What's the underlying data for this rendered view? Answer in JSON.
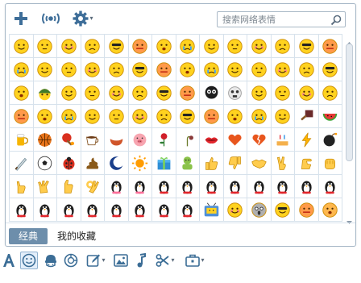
{
  "topbar": {
    "add_icon": "plus-icon",
    "gif_icon": "wifi-gif-icon",
    "settings_icon": "gear-icon"
  },
  "search": {
    "placeholder": "搜索网络表情",
    "icon": "magnifier-icon"
  },
  "tabs": [
    {
      "label": "经典",
      "selected": true
    },
    {
      "label": "我的收藏",
      "selected": false
    }
  ],
  "emoji_rows": [
    [
      "smile",
      "pout",
      "heart-eyes",
      "daze",
      "cool",
      "cry",
      "shy",
      "zip",
      "sleep",
      "weep",
      "awkward",
      "angry",
      "tongue",
      "grin"
    ],
    [
      "surprise",
      "sad",
      "cool-glasses",
      "sweat",
      "crazy",
      "vomit",
      "giggle",
      "cute",
      "roll-eyes",
      "proud",
      "hungry",
      "sleepy",
      "fright",
      "sweat-drop"
    ],
    [
      "laugh",
      "soldier",
      "struggle",
      "curse",
      "question",
      "shh",
      "dizzy",
      "torment",
      "skull",
      "knock",
      "bye",
      "wipe-sweat",
      "pick-nose",
      "clap"
    ],
    [
      "embarrassed",
      "snicker",
      "left-hum",
      "right-hum",
      "yawn",
      "despise",
      "grievance",
      "tear",
      "sly",
      "kiss",
      "scare",
      "pitiful",
      "cleaver",
      "melon"
    ],
    [
      "beer",
      "basketball",
      "ping-pong",
      "coffee",
      "rice",
      "pig",
      "rose",
      "wilt",
      "lips",
      "heart",
      "broken-heart",
      "cake",
      "lightning",
      "bomb"
    ],
    [
      "knife",
      "football",
      "ladybug",
      "poop",
      "moon",
      "sun",
      "gift",
      "hug",
      "thumbs-up",
      "thumbs-down",
      "handshake",
      "victory",
      "salute",
      "fist"
    ],
    [
      "pinky",
      "love-you",
      "no",
      "ok",
      "couple",
      "couple-kiss",
      "penguin-dance",
      "penguin-shiver",
      "penguin-angry",
      "penguin-spin",
      "penguin-jump",
      "penguin-wave",
      "penguin-kowtow",
      "penguin-turn"
    ],
    [
      "penguin-jump-rope",
      "penguin-flag",
      "penguin-dance-2",
      "penguin-love",
      "penguin-kiss",
      "penguin-taichi",
      "penguin-left",
      "penguin-right",
      "tv-head",
      "smile-2",
      "scream",
      "frown",
      "look-up",
      "sigh"
    ]
  ],
  "scrollbar": {
    "position": 0.0,
    "visible_fraction": 0.63
  },
  "toolbar": {
    "items": [
      "font-icon",
      "emoji-icon",
      "vip-emoji-icon",
      "gif-icon",
      "doodle-icon",
      "image-icon",
      "music-icon",
      "screenshot-icon",
      "more-icon"
    ],
    "dropdown_caret": "▾"
  },
  "colors": {
    "accent": "#6d8eab",
    "grid_line": "#d7e2ec",
    "face_yellow": "#ffd21f",
    "icon_blue": "#3b6d96"
  }
}
